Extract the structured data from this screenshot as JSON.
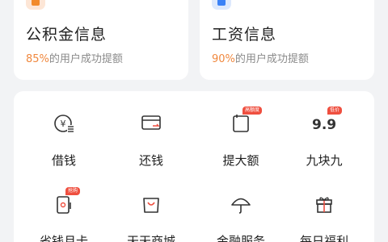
{
  "colors": {
    "accent_orange": "#f0883e",
    "accent_blue": "#3b82f6",
    "badge_red": "#ef4f3f"
  },
  "info_cards": [
    {
      "icon": "orange-card-icon",
      "title": "公积金信息",
      "pct": "85%",
      "suffix": "的用户成功提额"
    },
    {
      "icon": "blue-card-icon",
      "title": "工资信息",
      "pct": "90%",
      "suffix": "的用户成功提额"
    }
  ],
  "services": [
    {
      "label": "借钱",
      "icon": "yen-coin-icon"
    },
    {
      "label": "还钱",
      "icon": "card-repay-icon"
    },
    {
      "label": "提大额",
      "icon": "calendar-icon",
      "badge": "高额度"
    },
    {
      "label": "九块九",
      "icon": "nine-nine-icon",
      "badge": "低价",
      "glyph": "9.9"
    },
    {
      "label": "省钱月卡",
      "icon": "phone-coupon-icon",
      "badge": "抢购"
    },
    {
      "label": "天天商城",
      "icon": "shopping-bag-icon"
    },
    {
      "label": "金融服务",
      "icon": "umbrella-icon"
    },
    {
      "label": "每日福利",
      "icon": "gift-icon"
    }
  ]
}
